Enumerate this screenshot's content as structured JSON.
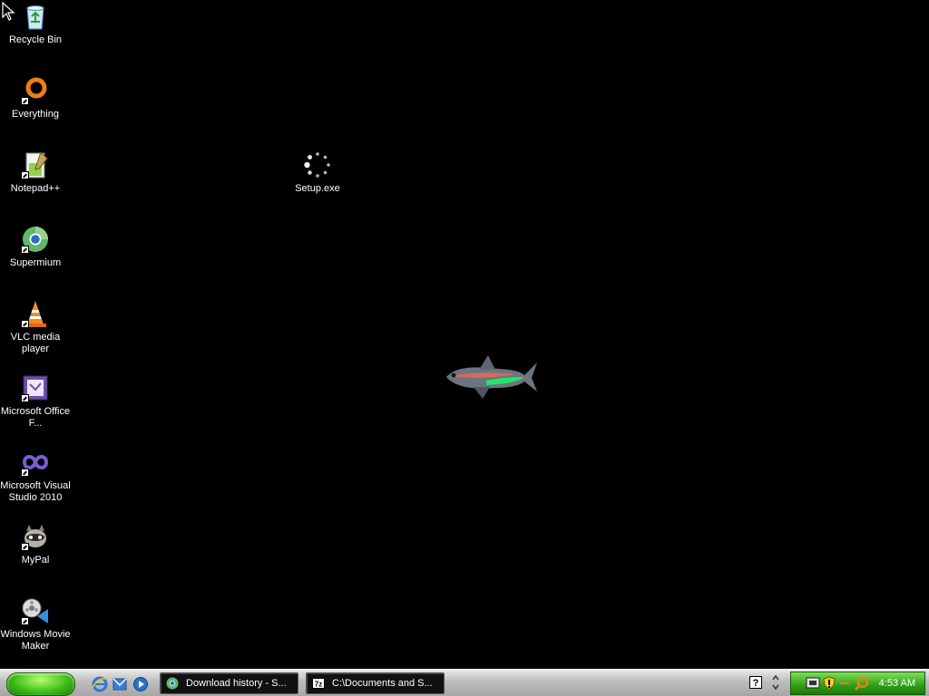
{
  "desktop": {
    "icons": [
      {
        "label": "Recycle Bin",
        "icon": "recycle-bin-icon"
      },
      {
        "label": "Everything",
        "icon": "everything-search-icon"
      },
      {
        "label": "Notepad++",
        "icon": "notepad-plus-plus-icon"
      },
      {
        "label": "Supermium",
        "icon": "supermium-browser-icon"
      },
      {
        "label": "VLC media player",
        "icon": "vlc-cone-icon"
      },
      {
        "label": "Microsoft Office F...",
        "icon": "office-form-icon"
      },
      {
        "label": "Microsoft Visual Studio 2010",
        "icon": "visual-studio-icon"
      },
      {
        "label": "MyPal",
        "icon": "mypal-raccoon-icon"
      },
      {
        "label": "Windows Movie Maker",
        "icon": "movie-maker-icon"
      },
      {
        "label": "Setup.exe",
        "icon": "loading-spinner-icon"
      }
    ]
  },
  "taskbar": {
    "quick_launch": [
      "internet-explorer-icon",
      "outlook-express-icon",
      "media-player-icon"
    ],
    "buttons": [
      {
        "label": "Download history - S...",
        "icon": "supermium-browser-icon"
      },
      {
        "label": "C:\\Documents and S...",
        "icon": "7zip-icon"
      }
    ],
    "tray": {
      "help_symbol": "?",
      "icons": [
        "network-icon",
        "security-shield-icon",
        "everything-search-icon"
      ],
      "clock": "4:53 AM"
    }
  },
  "colors": {
    "desktop": "#000000",
    "start_green": "#3fbf1a",
    "tray_green": "#2f9e18"
  }
}
